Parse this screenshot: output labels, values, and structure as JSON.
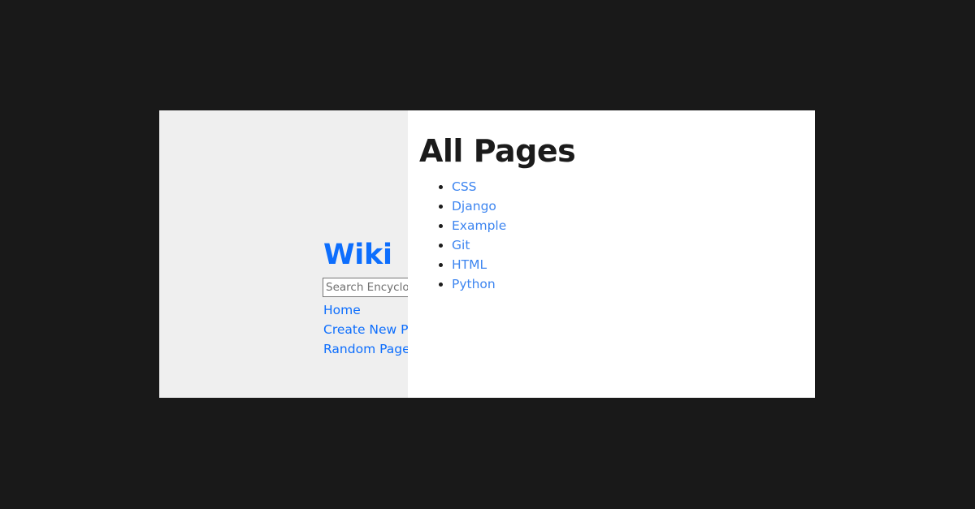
{
  "theme": {
    "page_background": "#191919",
    "card_background": "#ffffff",
    "sidebar_background": "#efefef",
    "link_color": "#0d6efd",
    "entry_link_color": "#3d85f0",
    "heading_color": "#1b1b1b",
    "input_border_color": "#767676"
  },
  "sidebar": {
    "brand": "Wiki",
    "search": {
      "placeholder": "Search Encyclopedia",
      "value": ""
    },
    "nav_items": [
      {
        "label": "Home"
      },
      {
        "label": "Create New Page"
      },
      {
        "label": "Random Page"
      }
    ]
  },
  "main": {
    "title": "All Pages",
    "entries": [
      {
        "label": "CSS"
      },
      {
        "label": "Django"
      },
      {
        "label": "Example"
      },
      {
        "label": "Git"
      },
      {
        "label": "HTML"
      },
      {
        "label": "Python"
      }
    ]
  }
}
